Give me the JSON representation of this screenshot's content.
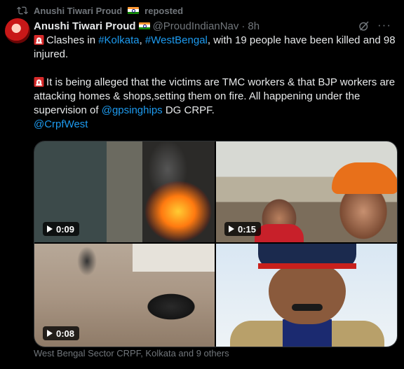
{
  "repost": {
    "reposter_name": "Anushi Tiwari Proud",
    "reposter_flag": "india-flag-icon",
    "label": "reposted"
  },
  "author": {
    "display_name": "Anushi Tiwari Proud",
    "flag": "india-flag-icon",
    "handle": "@ProudIndianNav",
    "separator": "·",
    "time": "8h"
  },
  "tweet": {
    "line1_pre": "Clashes in ",
    "line1_tag1": "#Kolkata",
    "line1_sep": ", ",
    "line1_tag2": "#WestBengal",
    "line1_post": ", with 19 people have been killed and 98 injured.",
    "line2_text": "It is being alleged that the victims are TMC workers & that BJP workers are attacking homes & shops,setting them on fire. All happening under the supervision of ",
    "line2_mention": "@gpsinghips",
    "line2_post": " DG CRPF.",
    "line3_mention": "@CrpfWest",
    "siren_icon": "police-siren-icon"
  },
  "media": [
    {
      "duration": "0:09",
      "kind": "video"
    },
    {
      "duration": "0:15",
      "kind": "video"
    },
    {
      "duration": "0:08",
      "kind": "video"
    },
    {
      "kind": "image"
    }
  ],
  "tagged_text": "West Bengal Sector CRPF, Kolkata and 9 others",
  "colors": {
    "background": "#000000",
    "text": "#e7e9ea",
    "secondary": "#71767b",
    "link": "#1d9bf0",
    "border": "#2f3336"
  }
}
